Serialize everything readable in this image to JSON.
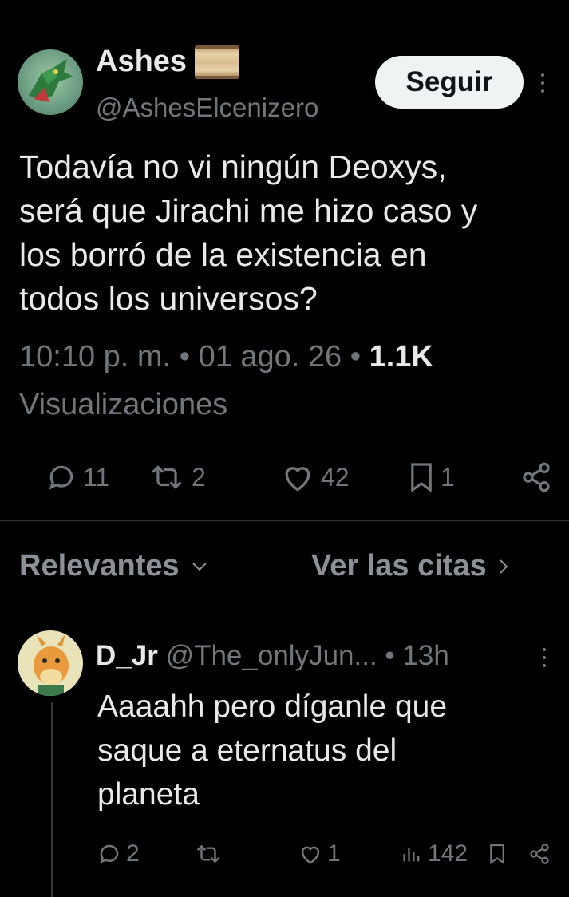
{
  "tweet": {
    "display_name": "Ashes",
    "handle": "@AshesElcenizero",
    "follow_label": "Seguir",
    "text_lines": [
      "Todavía no vi ningún Deoxys,",
      "será que Jirachi me hizo caso y",
      "los borró de la existencia en",
      "todos los universos?"
    ],
    "time": "10:10 p. m.",
    "date": "01 ago. 26",
    "views_count": "1.1K",
    "views_label": "Visualizaciones",
    "replies": "11",
    "retweets": "2",
    "likes": "42",
    "bookmarks": "1"
  },
  "tabs": {
    "sort_label": "Relevantes",
    "quotes_label": "Ver las citas"
  },
  "reply": {
    "display_name": "D_Jr",
    "handle": "@The_onlyJun...",
    "age": "13h",
    "text_lines": [
      "Aaaahh pero díganle que",
      "saque a eternatus del",
      "planeta"
    ],
    "replies": "2",
    "retweets": "",
    "likes": "1",
    "views": "142"
  },
  "colors": {
    "background": "#000000",
    "text_primary": "#e7e9ea",
    "text_secondary": "#71767b",
    "follow_button_bg": "#eff3f4"
  }
}
